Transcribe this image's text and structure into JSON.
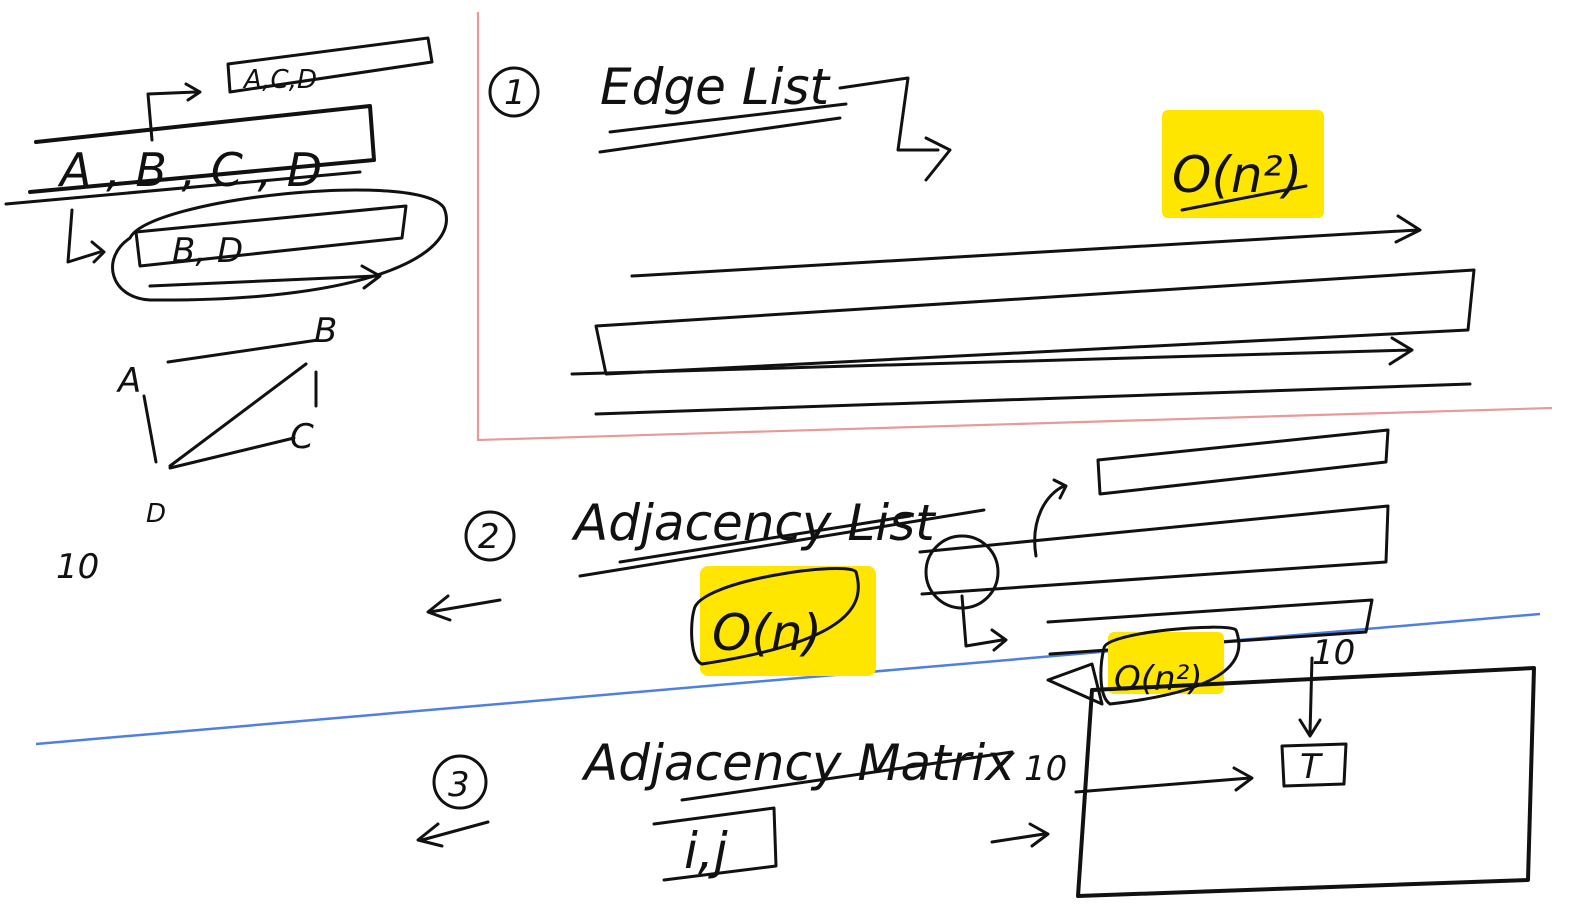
{
  "left_panel": {
    "list_row_top": "A,C,D",
    "list_row_main": "A , B , C , D",
    "list_row_sub": "B, D",
    "graph_nodes": [
      "A",
      "B",
      "C",
      "D"
    ],
    "count": "10"
  },
  "section_1": {
    "number": "1",
    "title": "Edge List",
    "complexity": "O(n²)"
  },
  "section_2": {
    "number": "2",
    "title": "Adjacency List",
    "complexity": "O(n)",
    "overlap_complexity": "O(n²)"
  },
  "section_3": {
    "number": "3",
    "title": "Adjacency Matrix",
    "index_label": "i,j",
    "rows_label": "10",
    "cols_label": "10",
    "cell_value": "T"
  },
  "colors": {
    "ink": "#111111",
    "highlight": "#ffe600",
    "divider_red": "#e79a9a",
    "divider_blue": "#4f7fe0"
  }
}
